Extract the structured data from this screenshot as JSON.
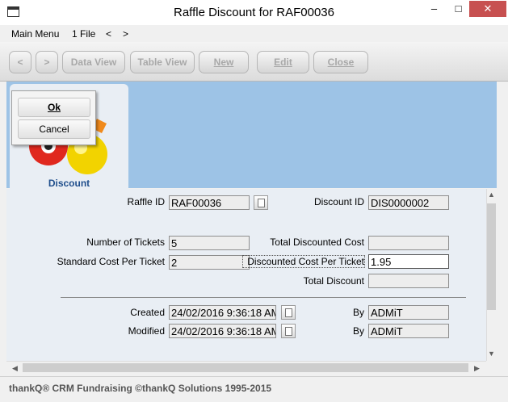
{
  "window": {
    "title": "Raffle Discount for RAF00036",
    "minimize": "–",
    "maximize": "□",
    "close": "✕"
  },
  "menu": {
    "main_menu": "Main Menu",
    "file": "1 File",
    "back": "<",
    "forward": ">"
  },
  "toolbar": {
    "prev": "<",
    "next": ">",
    "data_view": "Data View",
    "table_view": "Table View",
    "new": "New",
    "edit": "Edit",
    "close": "Close"
  },
  "popup": {
    "ok": "Ok",
    "cancel": "Cancel"
  },
  "tab": {
    "label": "Discount"
  },
  "form": {
    "raffle_id_label": "Raffle ID",
    "raffle_id": "RAF00036",
    "discount_id_label": "Discount ID",
    "discount_id": "DIS0000002",
    "number_of_tickets_label": "Number of Tickets",
    "number_of_tickets": "5",
    "total_discounted_cost_label": "Total Discounted Cost",
    "total_discounted_cost": "",
    "standard_cost_label": "Standard Cost Per Ticket",
    "standard_cost": "2",
    "discounted_cost_label": "Discounted Cost Per Ticket",
    "discounted_cost": "1.95",
    "total_discount_label": "Total Discount",
    "total_discount": "",
    "created_label": "Created",
    "created": "24/02/2016 9:36:18 AM",
    "created_by_label": "By",
    "created_by": "ADMiT",
    "modified_label": "Modified",
    "modified": "24/02/2016 9:36:18 AM",
    "modified_by_label": "By",
    "modified_by": "ADMiT"
  },
  "status": {
    "text": "thankQ® CRM Fundraising ©thankQ Solutions 1995-2015"
  },
  "icons": [
    "app-icon",
    "billiard-balls-icon",
    "lookup-icon"
  ]
}
